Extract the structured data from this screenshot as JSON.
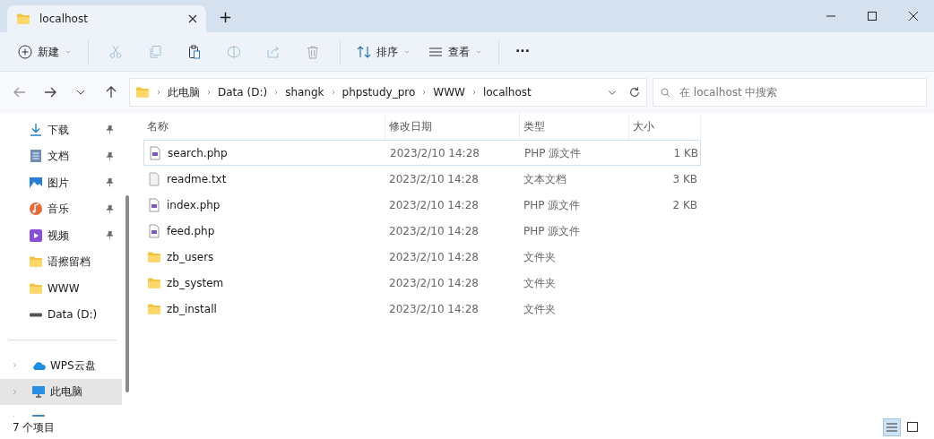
{
  "window": {
    "tab_title": "localhost",
    "new_tab": "+"
  },
  "toolbar": [
    {
      "kind": "new",
      "label": "新建",
      "disabled": false,
      "dropdown": true
    },
    {
      "kind": "cut",
      "disabled": true
    },
    {
      "kind": "copy",
      "disabled": true
    },
    {
      "kind": "paste",
      "disabled": false
    },
    {
      "kind": "rename",
      "disabled": true
    },
    {
      "kind": "share",
      "disabled": true
    },
    {
      "kind": "delete",
      "disabled": true
    },
    {
      "kind": "sort",
      "label": "排序",
      "disabled": false,
      "dropdown": true
    },
    {
      "kind": "view",
      "label": "查看",
      "disabled": false,
      "dropdown": true
    },
    {
      "kind": "more",
      "label": "···",
      "disabled": false,
      "dropdown": false
    }
  ],
  "breadcrumb": [
    "此电脑",
    "Data (D:)",
    "shangk",
    "phpstudy_pro",
    "WWW",
    "localhost"
  ],
  "search": {
    "placeholder": "在 localhost 中搜索"
  },
  "sidebar": {
    "quick": [
      {
        "kind": "download",
        "label": "下载",
        "pinned": true
      },
      {
        "kind": "docs",
        "label": "文档",
        "pinned": true
      },
      {
        "kind": "pictures",
        "label": "图片",
        "pinned": true
      },
      {
        "kind": "music",
        "label": "音乐",
        "pinned": true
      },
      {
        "kind": "video",
        "label": "视频",
        "pinned": true
      },
      {
        "kind": "folder",
        "label": "语擦留档",
        "pinned": false
      },
      {
        "kind": "folder",
        "label": "WWW",
        "pinned": false
      },
      {
        "kind": "drive",
        "label": "Data (D:)",
        "pinned": false
      }
    ],
    "roots": [
      {
        "kind": "cloud",
        "label": "WPS云盘",
        "selected": false
      },
      {
        "kind": "pc",
        "label": "此电脑",
        "selected": true
      },
      {
        "kind": "network",
        "selected": false
      }
    ]
  },
  "table": {
    "columns": [
      "名称",
      "修改日期",
      "类型",
      "大小"
    ],
    "rows": [
      {
        "kind": "php",
        "name": "search.php",
        "date": "2023/2/10 14:28",
        "type": "PHP 源文件",
        "size": "1 KB",
        "selected": true
      },
      {
        "kind": "txt",
        "name": "readme.txt",
        "date": "2023/2/10 14:28",
        "type": "文本文档",
        "size": "3 KB",
        "selected": false
      },
      {
        "kind": "php",
        "name": "index.php",
        "date": "2023/2/10 14:28",
        "type": "PHP 源文件",
        "size": "2 KB",
        "selected": false
      },
      {
        "kind": "php",
        "name": "feed.php",
        "date": "2023/2/10 14:28",
        "type": "PHP 源文件",
        "selected": false
      },
      {
        "kind": "folder",
        "name": "zb_users",
        "date": "2023/2/10 14:28",
        "type": "文件夹",
        "selected": false
      },
      {
        "kind": "folder",
        "name": "zb_system",
        "date": "2023/2/10 14:28",
        "type": "文件夹",
        "selected": false
      },
      {
        "kind": "folder",
        "name": "zb_install",
        "date": "2023/2/10 14:28",
        "type": "文件夹",
        "selected": false
      }
    ]
  },
  "status_bar": {
    "count": "7 个项目",
    "view_modes": [
      {
        "kind": "details",
        "selected": true
      },
      {
        "kind": "tiles",
        "selected": false
      }
    ]
  }
}
